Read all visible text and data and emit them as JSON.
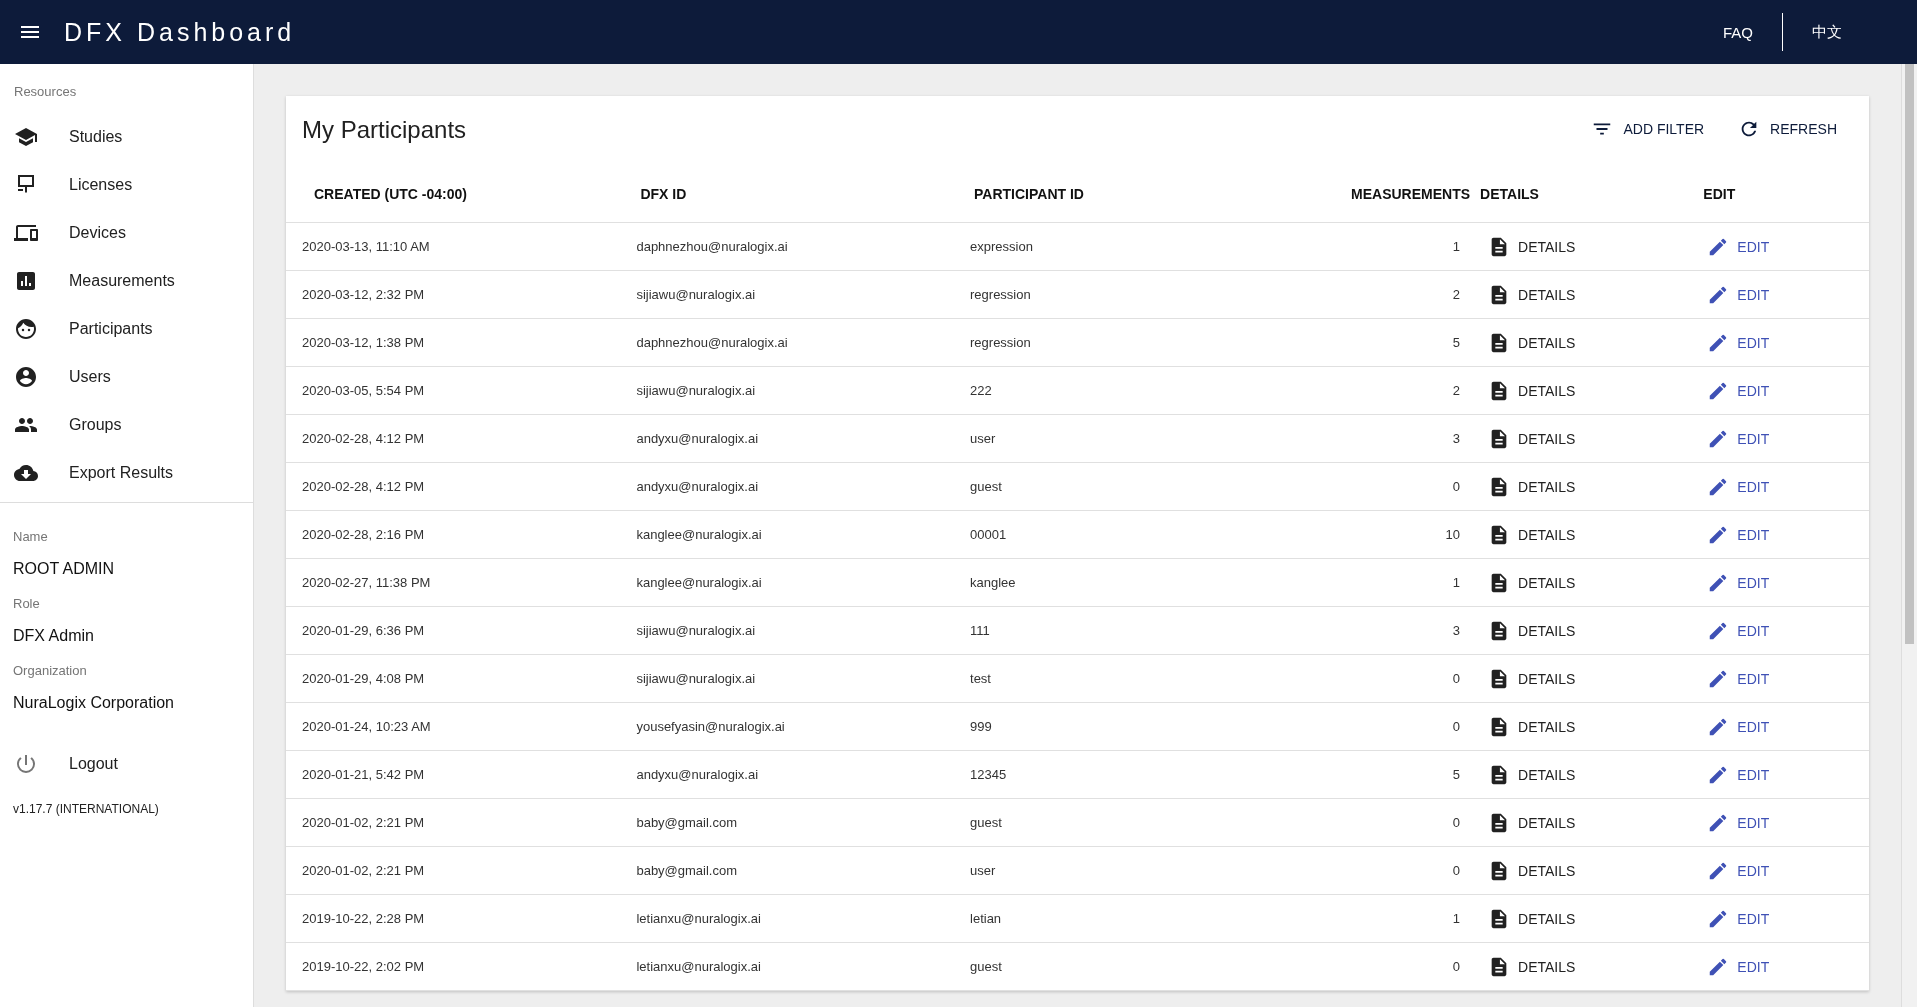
{
  "app_bar": {
    "title": "DFX Dashboard",
    "links": [
      "FAQ",
      "中文"
    ]
  },
  "sidebar": {
    "section_label": "Resources",
    "items": [
      {
        "label": "Studies",
        "selected": false
      },
      {
        "label": "Licenses",
        "selected": false
      },
      {
        "label": "Devices",
        "selected": false
      },
      {
        "label": "Measurements",
        "selected": false
      },
      {
        "label": "Participants",
        "selected": false
      },
      {
        "label": "Users",
        "selected": false
      },
      {
        "label": "Groups",
        "selected": false
      },
      {
        "label": "Export Results",
        "selected": false
      }
    ],
    "profile": [
      {
        "label": "Name",
        "value": "ROOT ADMIN"
      },
      {
        "label": "Role",
        "value": "DFX Admin"
      },
      {
        "label": "Organization",
        "value": "NuraLogix Corporation"
      }
    ],
    "logout": "Logout",
    "version": "v1.17.7 (INTERNATIONAL)"
  },
  "card": {
    "title": "My Participants",
    "actions": [
      "ADD FILTER",
      "REFRESH"
    ],
    "columns": [
      "CREATED (UTC -04:00)",
      "DFX ID",
      "PARTICIPANT ID",
      "MEASUREMENTS",
      "DETAILS",
      "EDIT"
    ],
    "rows": [
      {
        "created": "2020-03-13, 11:10 AM",
        "dfx_id": "daphnezhou@nuralogix.ai",
        "participant_id": "expression",
        "measurements": "1",
        "details": "DETAILS",
        "edit": "EDIT"
      },
      {
        "created": "2020-03-12, 2:32 PM",
        "dfx_id": "sijiawu@nuralogix.ai",
        "participant_id": "regression",
        "measurements": "2",
        "details": "DETAILS",
        "edit": "EDIT"
      },
      {
        "created": "2020-03-12, 1:38 PM",
        "dfx_id": "daphnezhou@nuralogix.ai",
        "participant_id": "regression",
        "measurements": "5",
        "details": "DETAILS",
        "edit": "EDIT"
      },
      {
        "created": "2020-03-05, 5:54 PM",
        "dfx_id": "sijiawu@nuralogix.ai",
        "participant_id": "222",
        "measurements": "2",
        "details": "DETAILS",
        "edit": "EDIT"
      },
      {
        "created": "2020-02-28, 4:12 PM",
        "dfx_id": "andyxu@nuralogix.ai",
        "participant_id": "user",
        "measurements": "3",
        "details": "DETAILS",
        "edit": "EDIT"
      },
      {
        "created": "2020-02-28, 4:12 PM",
        "dfx_id": "andyxu@nuralogix.ai",
        "participant_id": "guest",
        "measurements": "0",
        "details": "DETAILS",
        "edit": "EDIT"
      },
      {
        "created": "2020-02-28, 2:16 PM",
        "dfx_id": "kanglee@nuralogix.ai",
        "participant_id": "00001",
        "measurements": "10",
        "details": "DETAILS",
        "edit": "EDIT"
      },
      {
        "created": "2020-02-27, 11:38 PM",
        "dfx_id": "kanglee@nuralogix.ai",
        "participant_id": "kanglee",
        "measurements": "1",
        "details": "DETAILS",
        "edit": "EDIT"
      },
      {
        "created": "2020-01-29, 6:36 PM",
        "dfx_id": "sijiawu@nuralogix.ai",
        "participant_id": "111",
        "measurements": "3",
        "details": "DETAILS",
        "edit": "EDIT"
      },
      {
        "created": "2020-01-29, 4:08 PM",
        "dfx_id": "sijiawu@nuralogix.ai",
        "participant_id": "test",
        "measurements": "0",
        "details": "DETAILS",
        "edit": "EDIT"
      },
      {
        "created": "2020-01-24, 10:23 AM",
        "dfx_id": "yousefyasin@nuralogix.ai",
        "participant_id": "999",
        "measurements": "0",
        "details": "DETAILS",
        "edit": "EDIT"
      },
      {
        "created": "2020-01-21, 5:42 PM",
        "dfx_id": "andyxu@nuralogix.ai",
        "participant_id": "12345",
        "measurements": "5",
        "details": "DETAILS",
        "edit": "EDIT"
      },
      {
        "created": "2020-01-02, 2:21 PM",
        "dfx_id": "baby@gmail.com",
        "participant_id": "guest",
        "measurements": "0",
        "details": "DETAILS",
        "edit": "EDIT"
      },
      {
        "created": "2020-01-02, 2:21 PM",
        "dfx_id": "baby@gmail.com",
        "participant_id": "user",
        "measurements": "0",
        "details": "DETAILS",
        "edit": "EDIT"
      },
      {
        "created": "2019-10-22, 2:28 PM",
        "dfx_id": "letianxu@nuralogix.ai",
        "participant_id": "letian",
        "measurements": "1",
        "details": "DETAILS",
        "edit": "EDIT"
      },
      {
        "created": "2019-10-22, 2:02 PM",
        "dfx_id": "letianxu@nuralogix.ai",
        "participant_id": "guest",
        "measurements": "0",
        "details": "DETAILS",
        "edit": "EDIT"
      }
    ]
  }
}
